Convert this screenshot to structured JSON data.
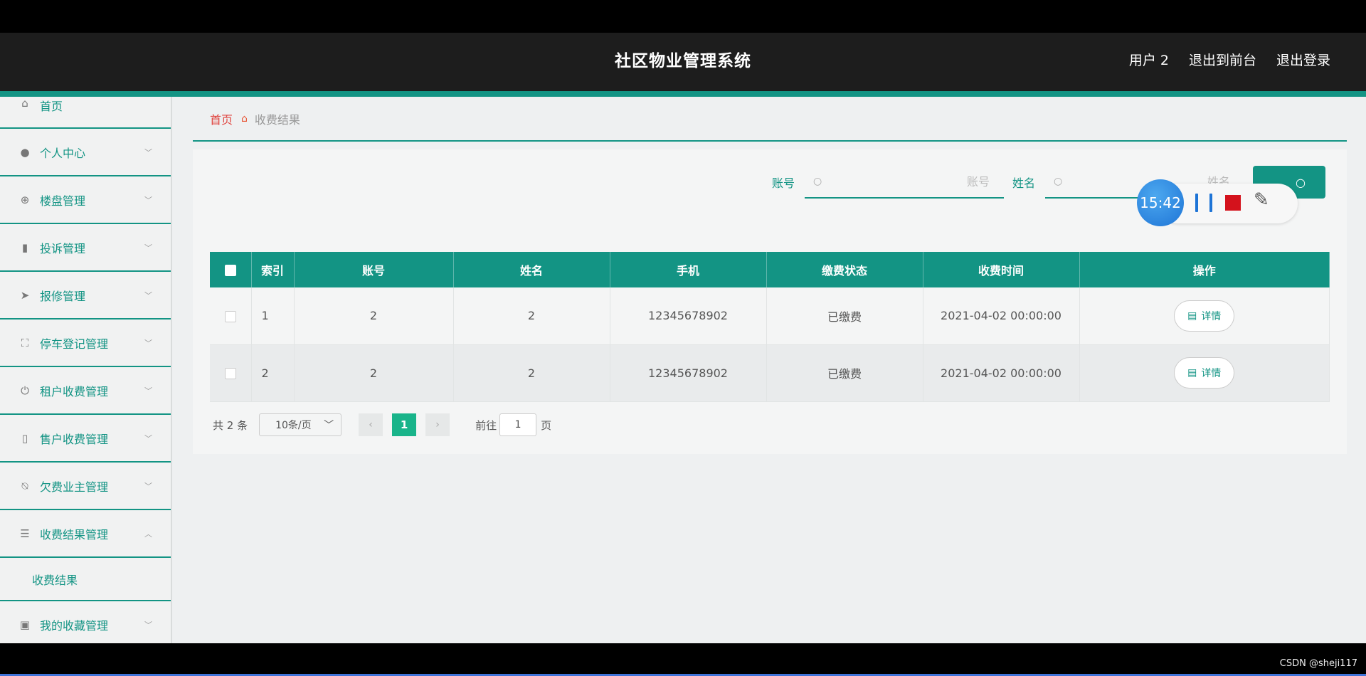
{
  "header": {
    "title": "社区物业管理系统",
    "links": [
      "用户 2",
      "退出到前台",
      "退出登录"
    ]
  },
  "sidebar": {
    "items": [
      {
        "label": "首页",
        "icon": "home-icon"
      },
      {
        "label": "个人中心",
        "icon": "user-icon"
      },
      {
        "label": "楼盘管理",
        "icon": "target-icon"
      },
      {
        "label": "投诉管理",
        "icon": "books-icon"
      },
      {
        "label": "报修管理",
        "icon": "send-icon"
      },
      {
        "label": "停车登记管理",
        "icon": "fullscreen-icon"
      },
      {
        "label": "租户收费管理",
        "icon": "power-icon"
      },
      {
        "label": "售户收费管理",
        "icon": "cup-icon"
      },
      {
        "label": "欠费业主管理",
        "icon": "bell-off-icon"
      },
      {
        "label": "收费结果管理",
        "icon": "sliders-icon",
        "expanded": true
      },
      {
        "label": "我的收藏管理",
        "icon": "clipboard-icon"
      }
    ],
    "submenu_item": "收费结果"
  },
  "breadcrumb": {
    "home": "首页",
    "current": "收费结果"
  },
  "search": {
    "account_label": "账号",
    "account_placeholder": "账号",
    "name_label": "姓名",
    "name_placeholder": "姓名"
  },
  "table": {
    "columns": [
      "索引",
      "账号",
      "姓名",
      "手机",
      "缴费状态",
      "收费时间",
      "操作"
    ],
    "rows": [
      {
        "index": "1",
        "account": "2",
        "name": "2",
        "phone": "12345678902",
        "status": "已缴费",
        "time": "2021-04-02 00:00:00",
        "action": "详情"
      },
      {
        "index": "2",
        "account": "2",
        "name": "2",
        "phone": "12345678902",
        "status": "已缴费",
        "time": "2021-04-02 00:00:00",
        "action": "详情"
      }
    ]
  },
  "pagination": {
    "total": "共 2 条",
    "page_size": "10条/页",
    "current_page": "1",
    "goto_label": "前往",
    "goto_value": "1",
    "page_suffix": "页"
  },
  "recorder": {
    "timer": "15:42"
  },
  "watermark": "CSDN @sheji117",
  "colors": {
    "accent": "#139484",
    "topbar": "#1d1d1d",
    "breadcrumb_home": "#e0443f",
    "page_active": "#19b48a",
    "recorder_stop": "#d4121c"
  }
}
